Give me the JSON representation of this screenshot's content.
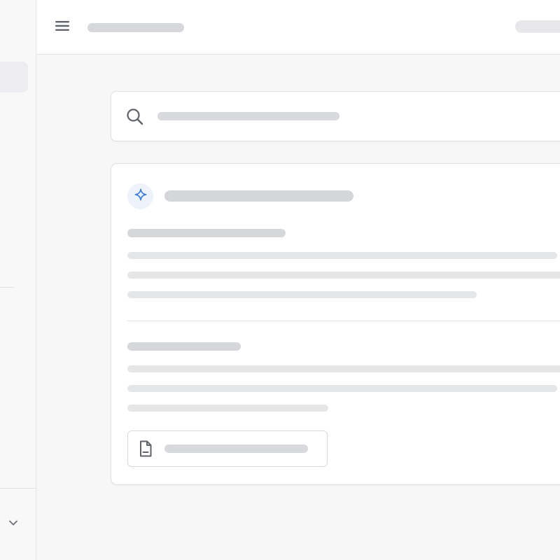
{
  "colors": {
    "page_background": "#f7f7f7",
    "surface": "#ffffff",
    "border": "#dfe0e3",
    "placeholder_heading": "#d4d6da",
    "placeholder_text": "#e5e6e8",
    "accent_blue": "#3f7fd8",
    "icon_gray": "#5f6368"
  },
  "icons": {
    "menu": "hamburger-menu-icon",
    "search": "search-icon",
    "sparkle": "sparkle-icon",
    "document": "document-icon",
    "chevron": "chevron-down-icon"
  }
}
